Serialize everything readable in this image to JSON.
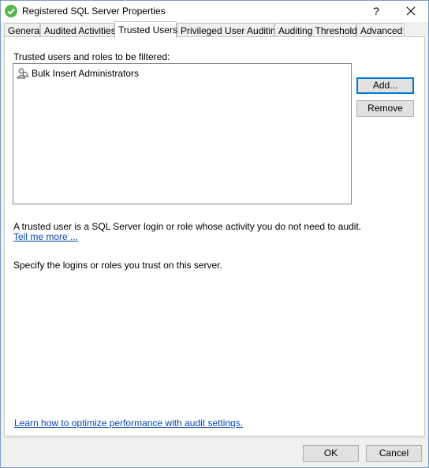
{
  "window": {
    "title": "Registered SQL Server Properties",
    "help_label": "?"
  },
  "tabs": [
    {
      "label": "General"
    },
    {
      "label": "Audited Activities"
    },
    {
      "label": "Trusted Users"
    },
    {
      "label": "Privileged User Auditing"
    },
    {
      "label": "Auditing Thresholds"
    },
    {
      "label": "Advanced"
    }
  ],
  "active_tab": "Trusted Users",
  "trusted": {
    "list_label": "Trusted users and roles to be filtered:",
    "items": [
      {
        "label": "Bulk Insert Administrators",
        "icon": "user-role-icon"
      }
    ],
    "add_label": "Add...",
    "remove_label": "Remove",
    "description": "A trusted user is a SQL Server login or role whose activity you do not need to audit.",
    "tell_me_more": "Tell me more ...",
    "specify": "Specify the logins or roles you trust on this server."
  },
  "footer": {
    "learn_link": "Learn how to optimize performance with audit settings.",
    "ok_label": "OK",
    "cancel_label": "Cancel"
  },
  "colors": {
    "title_icon": "#5ab552",
    "link": "#0645ad",
    "focus_border": "#0078d7"
  }
}
